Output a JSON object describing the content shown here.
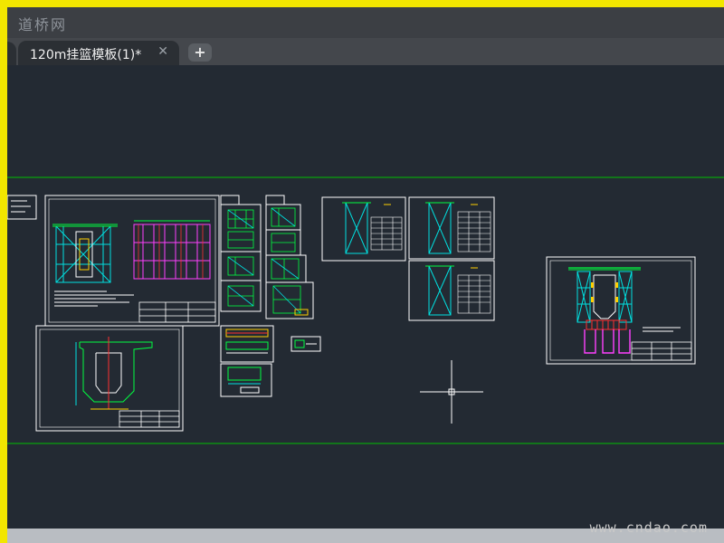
{
  "window": {
    "logo_text": "道桥网"
  },
  "tabs": [
    {
      "label": "120m挂篮模板(1)*",
      "active": true
    }
  ],
  "tab_controls": {
    "close_glyph": "✕",
    "add_glyph": "+"
  },
  "watermark": "www.cndao.com",
  "colors": {
    "canvas_bg": "#232a33",
    "frame_yellow": "#f2e600",
    "guide_line": "#00c000",
    "drawing_white": "#ffffff",
    "truss_cyan": "#00e0e0",
    "truss_green": "#00ff40",
    "rebar_red": "#ff3030",
    "tendon_magenta": "#ff40ff"
  },
  "icons": {
    "crosshair": "crosshair-cursor-icon",
    "close": "close-icon",
    "add": "plus-icon"
  }
}
